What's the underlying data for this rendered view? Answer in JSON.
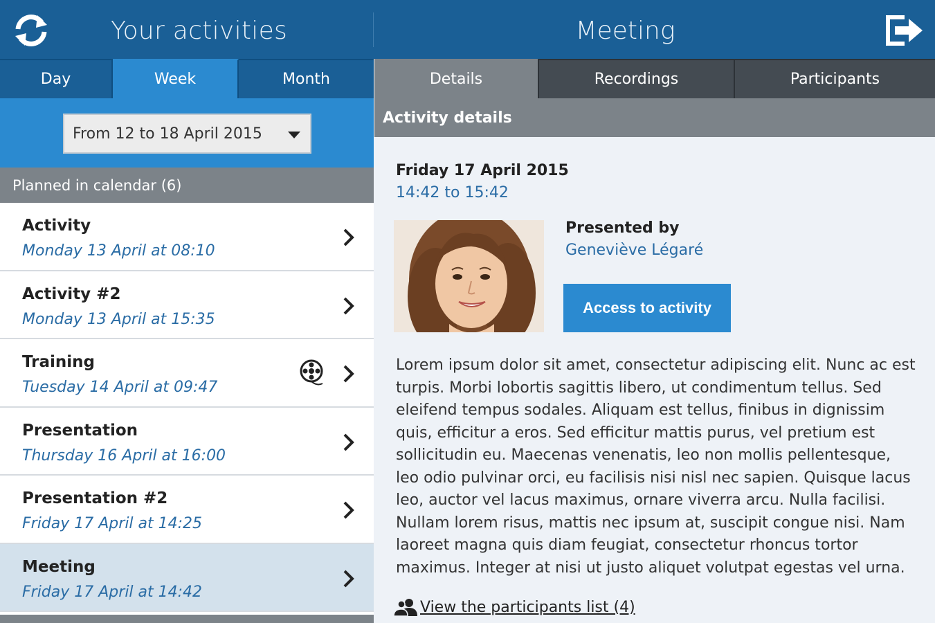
{
  "header": {
    "left_title": "Your activities",
    "right_title": "Meeting",
    "refresh_icon": "refresh-icon",
    "logout_icon": "logout-icon"
  },
  "period_tabs": [
    {
      "label": "Day",
      "active": false
    },
    {
      "label": "Week",
      "active": true
    },
    {
      "label": "Month",
      "active": false
    }
  ],
  "range": {
    "value": "From 12 to 18 April 2015"
  },
  "calendar": {
    "header": "Planned in calendar (6)",
    "activities": [
      {
        "title": "Activity",
        "date": "Monday 13 April at 08:10",
        "has_recording": false,
        "selected": false
      },
      {
        "title": "Activity #2",
        "date": "Monday 13 April at 15:35",
        "has_recording": false,
        "selected": false
      },
      {
        "title": "Training",
        "date": "Tuesday 14 April at 09:47",
        "has_recording": true,
        "selected": false
      },
      {
        "title": "Presentation",
        "date": "Thursday 16 April at 16:00",
        "has_recording": false,
        "selected": false
      },
      {
        "title": "Presentation #2",
        "date": "Friday 17 April at 14:25",
        "has_recording": false,
        "selected": false
      },
      {
        "title": "Meeting",
        "date": "Friday 17 April at 14:42",
        "has_recording": false,
        "selected": true
      }
    ]
  },
  "detail_tabs": [
    {
      "label": "Details",
      "active": true
    },
    {
      "label": "Recordings",
      "active": false
    },
    {
      "label": "Participants",
      "active": false
    }
  ],
  "details": {
    "section_title": "Activity details",
    "date": "Friday 17 April 2015",
    "time": "14:42 to 15:42",
    "presented_by_label": "Presented by",
    "presenter": "Geneviève Légaré",
    "access_button": "Access to activity",
    "description": "Lorem ipsum dolor sit amet, consectetur adipiscing elit. Nunc ac est turpis. Morbi lobortis sagittis libero, ut condimentum tellus. Sed eleifend tempus sodales. Aliquam est tellus, finibus in dignissim quis, efficitur a eros. Sed efficitur mattis purus, vel pretium est sollicitudin eu. Maecenas venenatis, leo non mollis pellentesque, leo odio pulvinar orci, eu facilisis nisi nisl nec sapien. Quisque lacus leo, auctor vel lacus maximus, ornare viverra arcu. Nulla facilisi. Nullam lorem risus, mattis nec ipsum at, suscipit congue nisi. Nam laoreet magna quis diam feugiat, consectetur rhoncus tortor maximus. Integer at nisi ut justo aliquet volutpat egestas vel urna.",
    "participants_link": "View the participants list (4)"
  },
  "colors": {
    "header_bg": "#1a5f96",
    "accent": "#2b8ad0",
    "gray_header": "#7c8389",
    "link_blue": "#2a6ca5",
    "selected_row": "#d3e1ec"
  }
}
